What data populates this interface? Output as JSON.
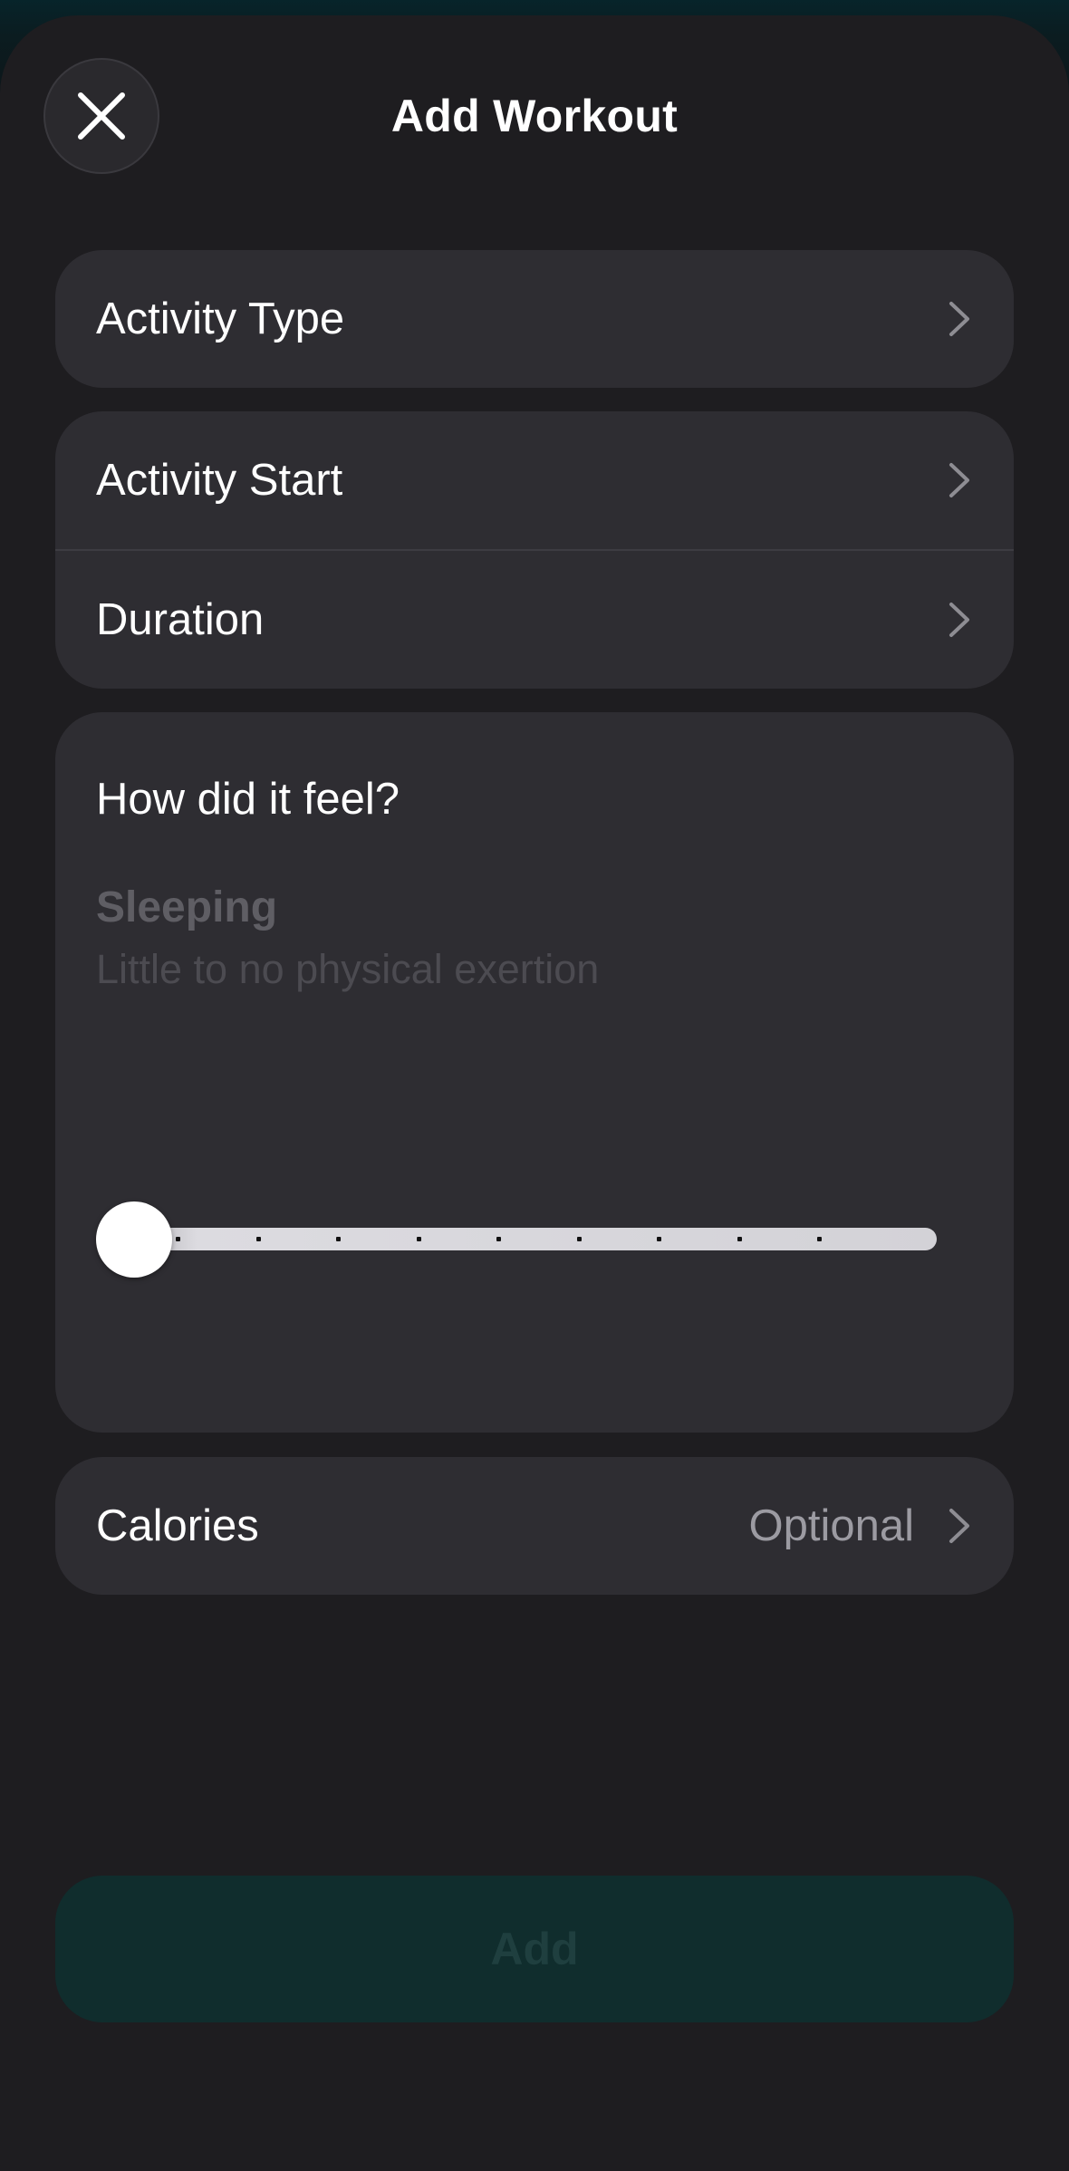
{
  "header": {
    "title": "Add Workout",
    "close_icon": "close-icon"
  },
  "rows": {
    "activity_type": "Activity Type",
    "activity_start": "Activity Start",
    "duration": "Duration",
    "calories": "Calories",
    "calories_value": "Optional"
  },
  "feel": {
    "title": "How did it feel?",
    "level": "Sleeping",
    "description": "Little to no physical exertion",
    "slider_value": 0,
    "slider_steps": 10
  },
  "footer": {
    "add_label": "Add"
  },
  "colors": {
    "sheet_background": "#1e1d20",
    "card_background": "#2e2d32",
    "add_button_background": "#102d2d"
  }
}
